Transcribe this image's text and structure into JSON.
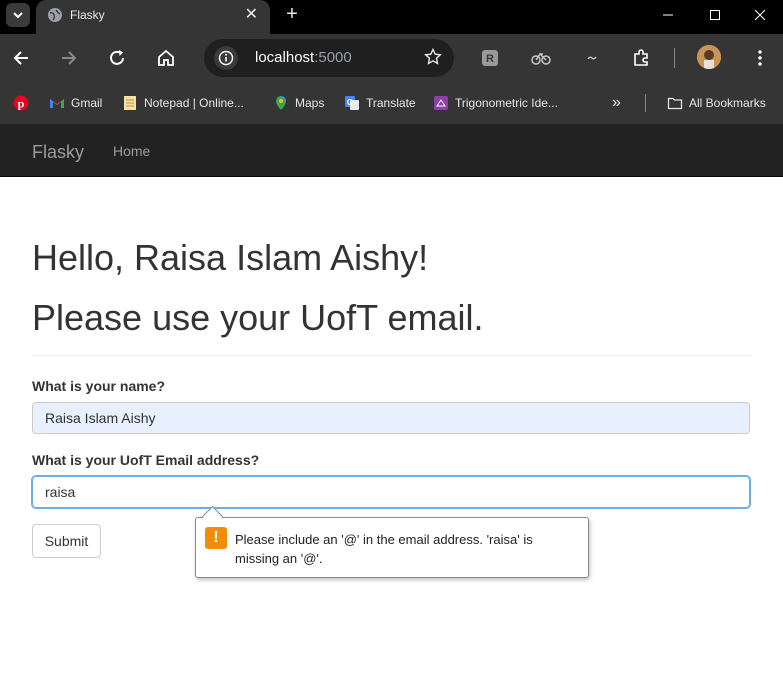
{
  "browser": {
    "tab_title": "Flasky",
    "address_host": "localhost",
    "address_port": ":5000",
    "bookmarks": [
      {
        "label": "",
        "icon": "pinterest-icon"
      },
      {
        "label": "Gmail",
        "icon": "gmail-icon"
      },
      {
        "label": "Notepad | Online...",
        "icon": "notepad-icon"
      },
      {
        "label": "Maps",
        "icon": "maps-icon"
      },
      {
        "label": "Translate",
        "icon": "translate-icon"
      },
      {
        "label": "Trigonometric Ide...",
        "icon": "trig-icon"
      }
    ],
    "all_bookmarks": "All Bookmarks",
    "overflow": "»"
  },
  "navbar": {
    "brand": "Flasky",
    "home": "Home"
  },
  "page": {
    "greeting": "Hello, Raisa Islam Aishy!",
    "message": "Please use your UofT email.",
    "name_label": "What is your name?",
    "name_value": "Raisa Islam Aishy",
    "email_label": "What is your UofT Email address?",
    "email_value": "raisa",
    "submit": "Submit"
  },
  "validation": {
    "message": "Please include an '@' in the email address. 'raisa' is missing an '@'."
  },
  "colors": {
    "navbar": "#222222",
    "warning": "#f48c0b",
    "focus": "#66afe9"
  }
}
